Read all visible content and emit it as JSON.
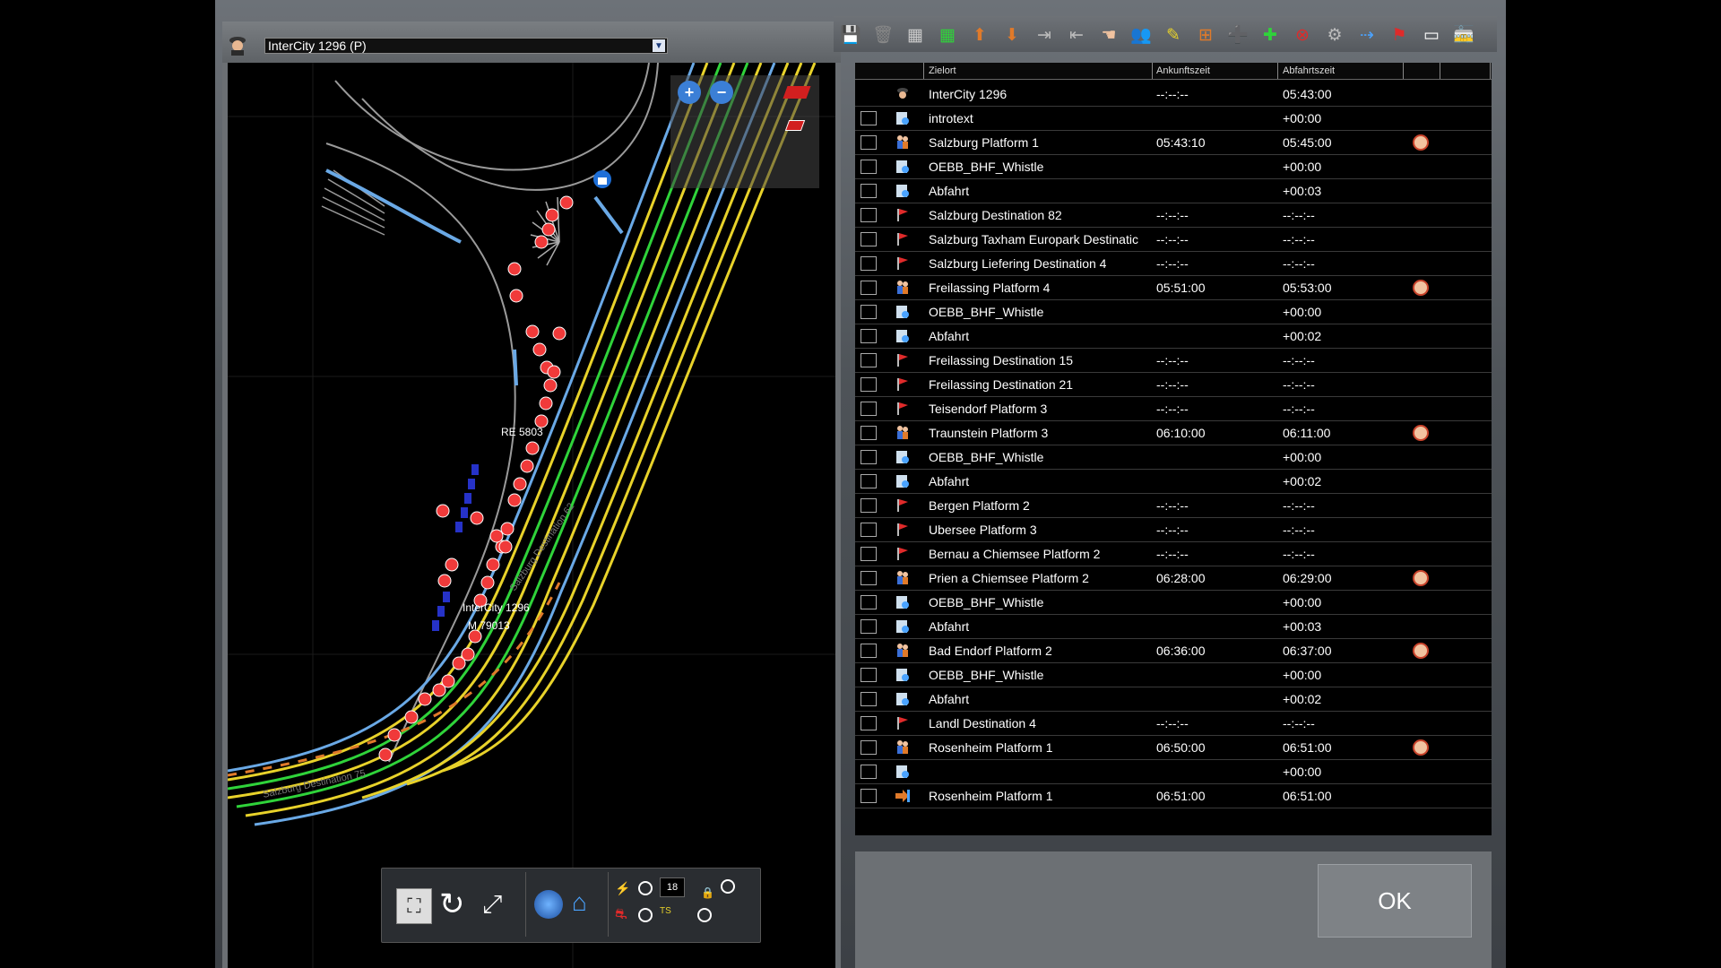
{
  "train_select": {
    "value": "InterCity 1296 (P)",
    "arrow_icon": "chevron-down-icon"
  },
  "map": {
    "labels": [
      "RE 5803",
      "InterCity 1296",
      "M 79013",
      "Salzburg Destination 75",
      "Salzburg Destination 62"
    ],
    "zoom_in": "zoom-in-icon",
    "zoom_out": "zoom-out-icon"
  },
  "map_toolbar": {
    "counter": "18"
  },
  "table": {
    "headers": {
      "destination": "Zielort",
      "arrival": "Ankunftszeit",
      "departure": "Abfahrtszeit"
    },
    "rows": [
      {
        "icon": "driver-icon",
        "dest": "InterCity 1296",
        "arr": "--:--:--",
        "dep": "05:43:00",
        "alarm": false,
        "checkbox": false
      },
      {
        "icon": "instruction-icon",
        "dest": "introtext",
        "arr": "",
        "dep": "+00:00",
        "alarm": false,
        "checkbox": true
      },
      {
        "icon": "passenger-icon",
        "dest": "Salzburg Platform 1",
        "arr": "05:43:10",
        "dep": "05:45:00",
        "alarm": true,
        "checkbox": true
      },
      {
        "icon": "instruction-icon",
        "dest": "OEBB_BHF_Whistle",
        "arr": "",
        "dep": "+00:00",
        "alarm": false,
        "checkbox": true
      },
      {
        "icon": "instruction-icon",
        "dest": "Abfahrt",
        "arr": "",
        "dep": "+00:03",
        "alarm": false,
        "checkbox": true
      },
      {
        "icon": "flag-icon",
        "dest": "Salzburg Destination 82",
        "arr": "--:--:--",
        "dep": "--:--:--",
        "alarm": false,
        "checkbox": true
      },
      {
        "icon": "flag-icon",
        "dest": "Salzburg Taxham Europark Destinatic",
        "arr": "--:--:--",
        "dep": "--:--:--",
        "alarm": false,
        "checkbox": true
      },
      {
        "icon": "flag-icon",
        "dest": "Salzburg Liefering Destination 4",
        "arr": "--:--:--",
        "dep": "--:--:--",
        "alarm": false,
        "checkbox": true
      },
      {
        "icon": "passenger-icon",
        "dest": "Freilassing Platform 4",
        "arr": "05:51:00",
        "dep": "05:53:00",
        "alarm": true,
        "checkbox": true
      },
      {
        "icon": "instruction-icon",
        "dest": "OEBB_BHF_Whistle",
        "arr": "",
        "dep": "+00:00",
        "alarm": false,
        "checkbox": true
      },
      {
        "icon": "instruction-icon",
        "dest": "Abfahrt",
        "arr": "",
        "dep": "+00:02",
        "alarm": false,
        "checkbox": true
      },
      {
        "icon": "flag-icon",
        "dest": "Freilassing Destination 15",
        "arr": "--:--:--",
        "dep": "--:--:--",
        "alarm": false,
        "checkbox": true
      },
      {
        "icon": "flag-icon",
        "dest": "Freilassing Destination 21",
        "arr": "--:--:--",
        "dep": "--:--:--",
        "alarm": false,
        "checkbox": true
      },
      {
        "icon": "flag-icon",
        "dest": "Teisendorf Platform 3",
        "arr": "--:--:--",
        "dep": "--:--:--",
        "alarm": false,
        "checkbox": true
      },
      {
        "icon": "passenger-icon",
        "dest": "Traunstein Platform 3",
        "arr": "06:10:00",
        "dep": "06:11:00",
        "alarm": true,
        "checkbox": true
      },
      {
        "icon": "instruction-icon",
        "dest": "OEBB_BHF_Whistle",
        "arr": "",
        "dep": "+00:00",
        "alarm": false,
        "checkbox": true
      },
      {
        "icon": "instruction-icon",
        "dest": "Abfahrt",
        "arr": "",
        "dep": "+00:02",
        "alarm": false,
        "checkbox": true
      },
      {
        "icon": "flag-icon",
        "dest": " Bergen Platform 2",
        "arr": "--:--:--",
        "dep": "--:--:--",
        "alarm": false,
        "checkbox": true
      },
      {
        "icon": "flag-icon",
        "dest": "Ubersee Platform 3",
        "arr": "--:--:--",
        "dep": "--:--:--",
        "alarm": false,
        "checkbox": true
      },
      {
        "icon": "flag-icon",
        "dest": "Bernau a Chiemsee Platform 2",
        "arr": "--:--:--",
        "dep": "--:--:--",
        "alarm": false,
        "checkbox": true
      },
      {
        "icon": "passenger-icon",
        "dest": "Prien a Chiemsee Platform 2",
        "arr": "06:28:00",
        "dep": "06:29:00",
        "alarm": true,
        "checkbox": true
      },
      {
        "icon": "instruction-icon",
        "dest": "OEBB_BHF_Whistle",
        "arr": "",
        "dep": "+00:00",
        "alarm": false,
        "checkbox": true
      },
      {
        "icon": "instruction-icon",
        "dest": "Abfahrt",
        "arr": "",
        "dep": "+00:03",
        "alarm": false,
        "checkbox": true
      },
      {
        "icon": "passenger-icon",
        "dest": "Bad Endorf Platform 2",
        "arr": "06:36:00",
        "dep": "06:37:00",
        "alarm": true,
        "checkbox": true
      },
      {
        "icon": "instruction-icon",
        "dest": "OEBB_BHF_Whistle",
        "arr": "",
        "dep": "+00:00",
        "alarm": false,
        "checkbox": true
      },
      {
        "icon": "instruction-icon",
        "dest": "Abfahrt",
        "arr": "",
        "dep": "+00:02",
        "alarm": false,
        "checkbox": true
      },
      {
        "icon": "flag-icon",
        "dest": "Landl Destination 4",
        "arr": "--:--:--",
        "dep": "--:--:--",
        "alarm": false,
        "checkbox": true
      },
      {
        "icon": "passenger-icon",
        "dest": "Rosenheim Platform 1",
        "arr": "06:50:00",
        "dep": "06:51:00",
        "alarm": true,
        "checkbox": true
      },
      {
        "icon": "instruction-icon",
        "dest": "",
        "arr": "",
        "dep": "+00:00",
        "alarm": false,
        "checkbox": true
      },
      {
        "icon": "stop-arrow-icon",
        "dest": "Rosenheim Platform 1",
        "arr": "06:51:00",
        "dep": "06:51:00",
        "alarm": false,
        "checkbox": true
      }
    ]
  },
  "ok_button": "OK",
  "colors": {
    "alarm_red": "#c8432b",
    "flag_red": "#e02a2a",
    "track_yellow": "#e8d22a",
    "track_green": "#2fd33a",
    "track_blue": "#6aa9e6",
    "marker_red": "#f03a3a"
  }
}
